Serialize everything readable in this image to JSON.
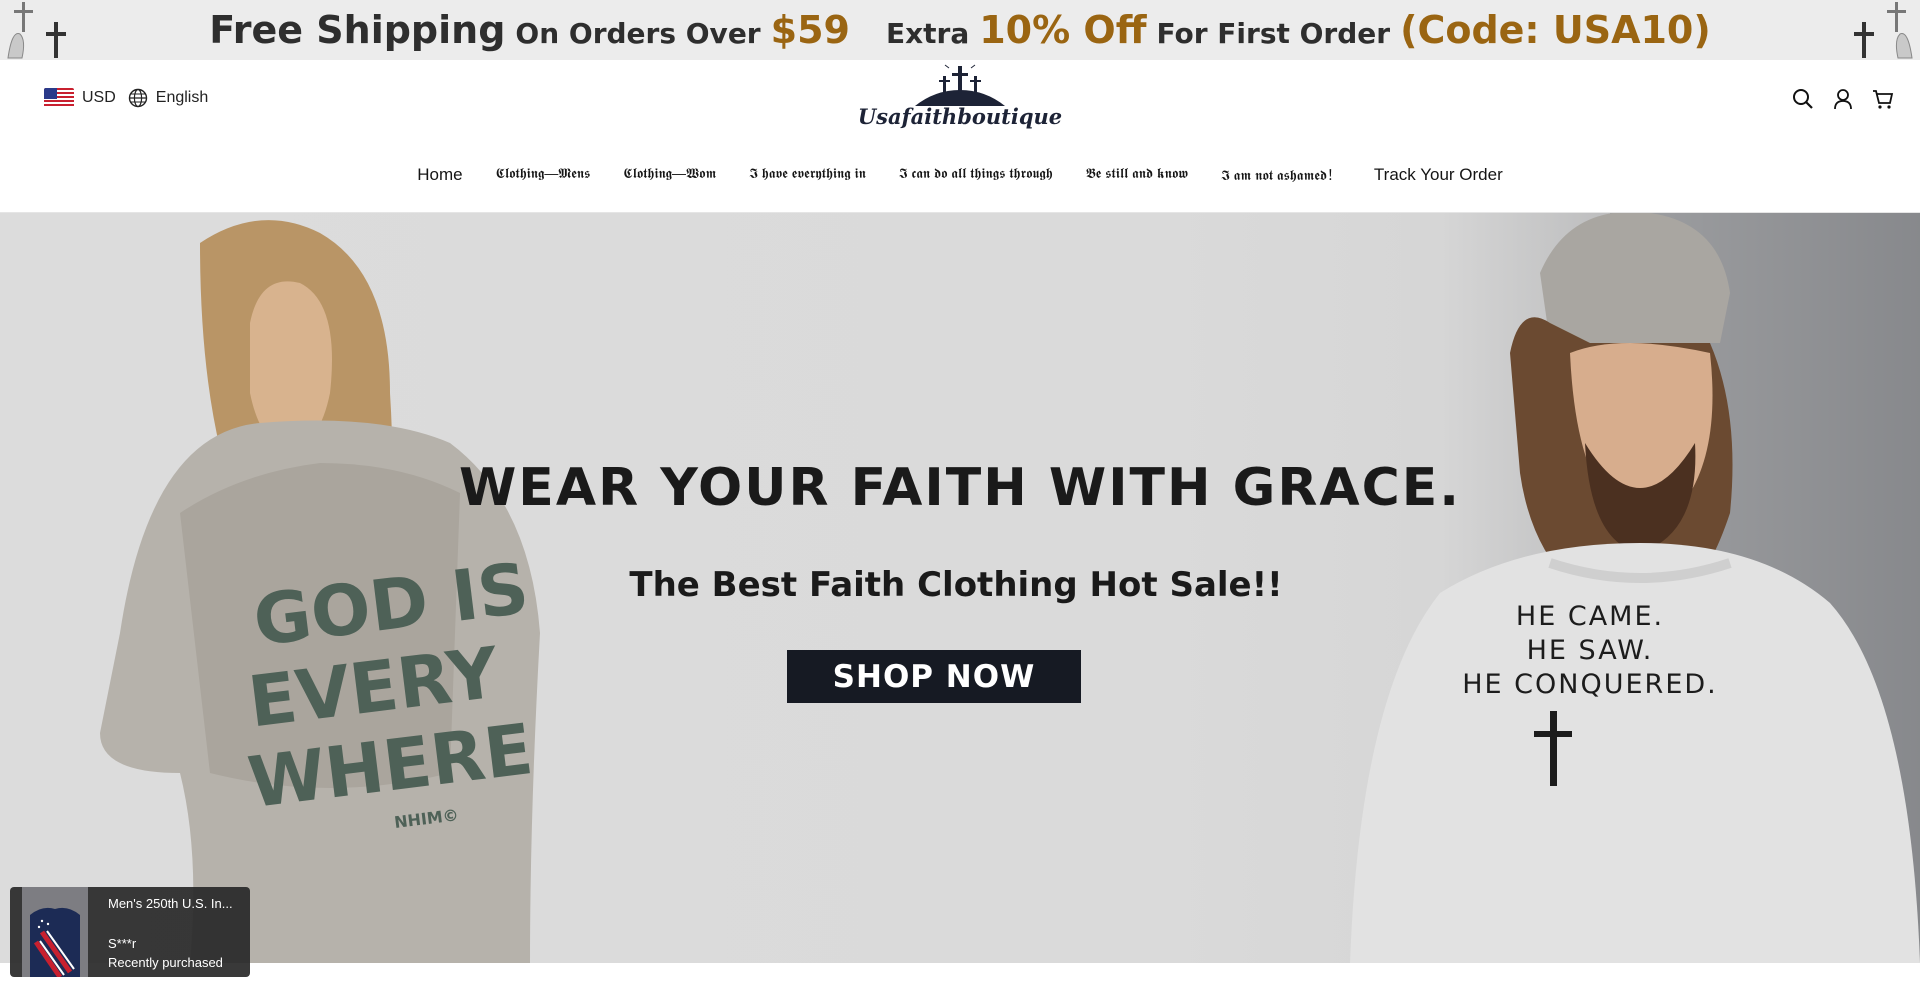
{
  "announcement": {
    "part1_big": "Free Shipping",
    "part1_mid": "On Orders Over",
    "part1_amount": "$59",
    "part2_mid": "Extra",
    "part2_big": "10% Off",
    "part2_mid2": "For First Order",
    "part2_code": "(Code: USA10)"
  },
  "header": {
    "currency": "USD",
    "language": "English",
    "brand": "Usafaithboutique",
    "icons": [
      "search-icon",
      "account-icon",
      "cart-icon"
    ]
  },
  "nav": {
    "items": [
      "Home",
      "𝕮𝖑𝖔𝖙𝖍𝖎𝖓𝖌—𝕸𝖊𝖓𝖘",
      "𝕮𝖑𝖔𝖙𝖍𝖎𝖓𝖌—𝖂𝖔𝖒",
      "𝕴 𝖍𝖆𝖛𝖊 𝖊𝖛𝖊𝖗𝖞𝖙𝖍𝖎𝖓𝖌 𝖎𝖓",
      "𝕴 𝖈𝖆𝖓 𝖉𝖔 𝖆𝖑𝖑 𝖙𝖍𝖎𝖓𝖌𝖘 𝖙𝖍𝖗𝖔𝖚𝖌𝖍",
      "𝕭𝖊 𝖘𝖙𝖎𝖑𝖑 𝖆𝖓𝖉 𝖐𝖓𝖔𝖜",
      "𝕴 𝖆𝖒 𝖓𝖔𝖙 𝖆𝖘𝖍𝖆𝖒𝖊𝖉！",
      "Track Your Order"
    ]
  },
  "hero": {
    "title": "WEAR YOUR FAITH WITH GRACE.",
    "subtitle": "The Best Faith Clothing Hot Sale!!",
    "button": "SHOP NOW",
    "left_shirt_text": "GOD IS EVERY WHERE",
    "left_shirt_tag": "NHIM©",
    "right_shirt_lines": [
      "HE CAME.",
      "HE SAW.",
      "HE CONQUERED."
    ]
  },
  "popup": {
    "product": "Men's 250th U.S. In...",
    "buyer": "S***r",
    "status": "Recently purchased"
  },
  "colors": {
    "gold": "#9a6512",
    "dark_button": "#161a23",
    "announce_bg": "#ececec"
  }
}
